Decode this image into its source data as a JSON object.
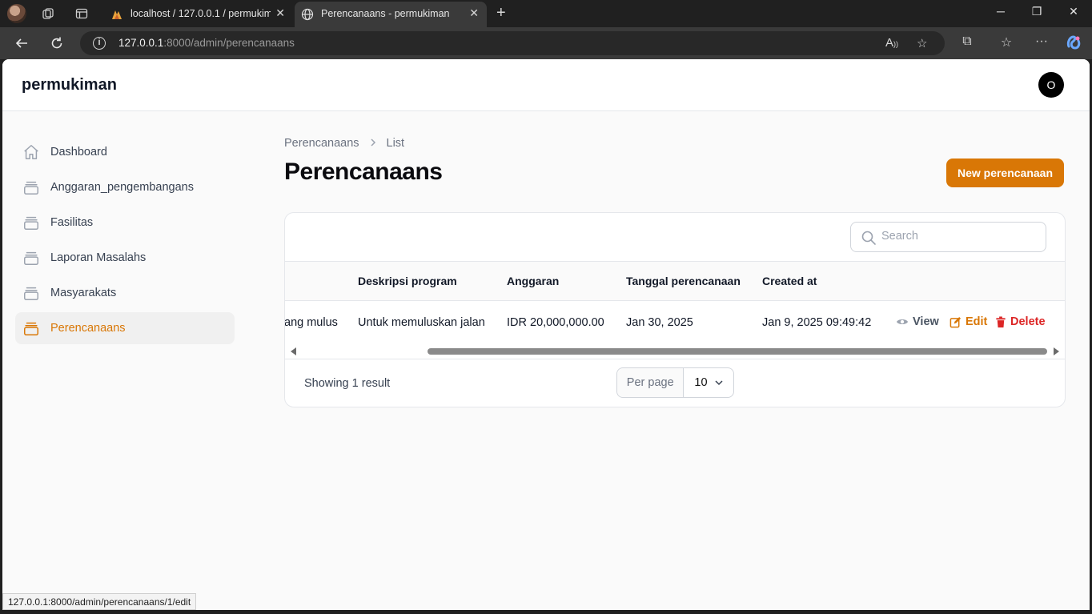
{
  "browser": {
    "tabs": [
      {
        "title": "localhost / 127.0.0.1 / permukiman",
        "active": false
      },
      {
        "title": "Perencanaans - permukiman",
        "active": true
      }
    ],
    "url_host": "127.0.0.1",
    "url_rest": ":8000/admin/perencanaans",
    "status_url": "127.0.0.1:8000/admin/perencanaans/1/edit"
  },
  "app": {
    "brand": "permukiman",
    "user_initial": "O",
    "accent_color": "#d97706"
  },
  "sidebar": {
    "items": [
      {
        "label": "Dashboard",
        "icon": "home-icon",
        "active": false
      },
      {
        "label": "Anggaran_pengembangans",
        "icon": "collection-icon",
        "active": false
      },
      {
        "label": "Fasilitas",
        "icon": "collection-icon",
        "active": false
      },
      {
        "label": "Laporan Masalahs",
        "icon": "collection-icon",
        "active": false
      },
      {
        "label": "Masyarakats",
        "icon": "collection-icon",
        "active": false
      },
      {
        "label": "Perencanaans",
        "icon": "collection-icon",
        "active": true
      }
    ]
  },
  "main": {
    "breadcrumbs": [
      "Perencanaans",
      "List"
    ],
    "title": "Perencanaans",
    "new_button": "New perencanaan",
    "search_placeholder": "Search",
    "table": {
      "columns": [
        "Deskripsi program",
        "Anggaran",
        "Tanggal perencanaan",
        "Created at"
      ],
      "rows": [
        {
          "nama_program": "ang mulus",
          "deskripsi_program": "Untuk memuluskan jalan",
          "anggaran": "IDR 20,000,000.00",
          "tanggal_perencanaan": "Jan 30, 2025",
          "created_at": "Jan 9, 2025 09:49:42",
          "actions": {
            "view": "View",
            "edit": "Edit",
            "delete": "Delete"
          }
        }
      ]
    },
    "footer": {
      "showing": "Showing 1 result",
      "per_page_label": "Per page",
      "per_page_value": "10"
    }
  }
}
